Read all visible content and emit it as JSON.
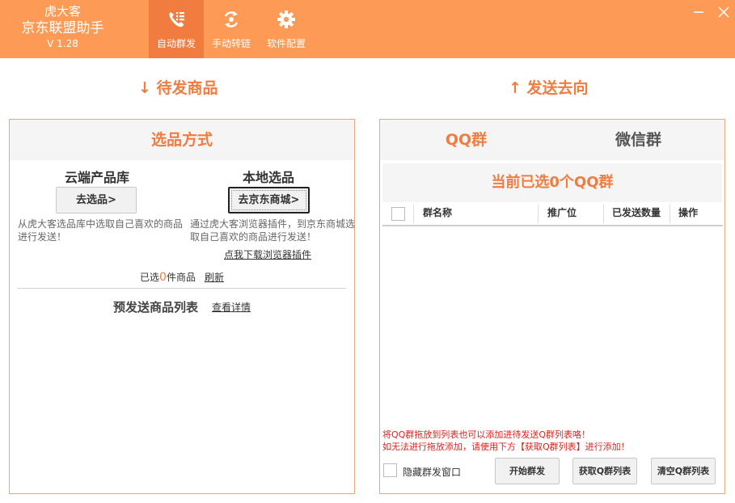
{
  "app": {
    "brand_line1": "虎大客",
    "brand_line2": "京东联盟助手",
    "version": "V 1.28"
  },
  "nav": {
    "tabs": [
      {
        "label": "自动群发",
        "icon": "phone-list-icon",
        "active": true
      },
      {
        "label": "手动转链",
        "icon": "link-cycle-icon",
        "active": false
      },
      {
        "label": "软件配置",
        "icon": "gear-icon",
        "active": false
      }
    ]
  },
  "left": {
    "section_heading": "待发商品",
    "panel_title": "选品方式",
    "cloud": {
      "title": "云端产品库",
      "button": "去选品>",
      "desc": "从虎大客选品库中选取自己喜欢的商品进行发送！"
    },
    "local": {
      "title": "本地选品",
      "button": "去京东商城>",
      "desc": "通过虎大客浏览器插件，到京东商城选取自己喜欢的商品进行发送！",
      "download_link": "点我下载浏览器插件"
    },
    "selected_prefix": "已选",
    "selected_count": "0",
    "selected_suffix": "件商品",
    "refresh_link": "刷新",
    "list_title": "预发送商品列表",
    "details_link": "查看详情"
  },
  "right": {
    "section_heading": "发送去向",
    "tabs": [
      {
        "label": "QQ群",
        "active": true
      },
      {
        "label": "微信群",
        "active": false
      }
    ],
    "status": "当前已选0个QQ群",
    "table_headers": [
      "群名称",
      "推广位",
      "已发送数量",
      "操作"
    ],
    "notice_line1": "将QQ群拖放到列表也可以添加进待发送Q群列表咯！",
    "notice_line2": "如无法进行拖放添加，请使用下方【获取Q群列表】进行添加！",
    "hide_window_label": "隐藏群发窗口",
    "buttons": {
      "start": "开始群发",
      "fetch": "获取Q群列表",
      "clear": "清空Q群列表"
    }
  },
  "colors": {
    "accent": "#fc9a56",
    "accent_dark": "#f07c3f",
    "warning": "#e0201c"
  }
}
